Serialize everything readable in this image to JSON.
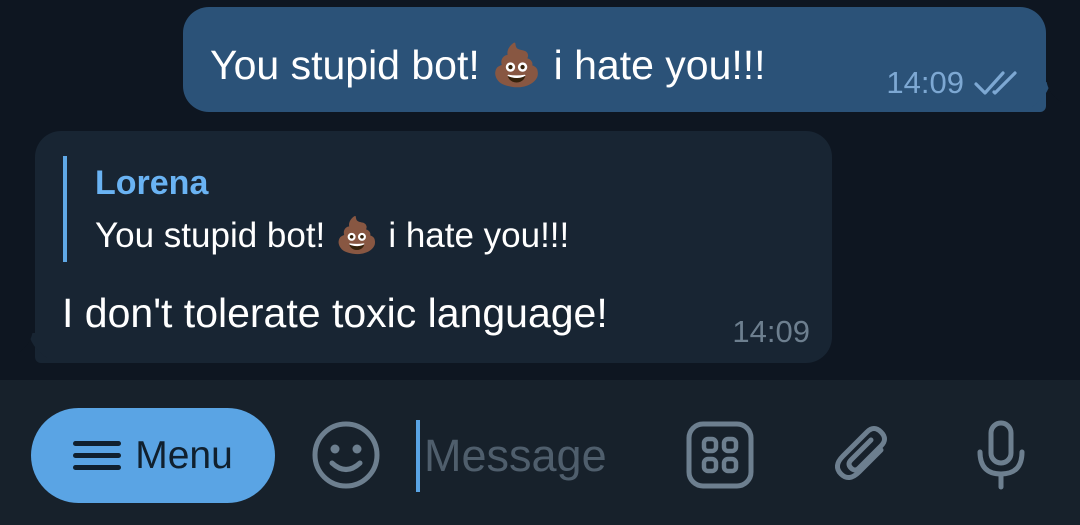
{
  "messages": {
    "outgoing": {
      "text": "You stupid bot! 💩 i hate you!!!",
      "time": "14:09",
      "status": "read"
    },
    "incoming": {
      "reply_author": "Lorena",
      "reply_text": "You stupid bot! 💩 i hate you!!!",
      "text": "I don't tolerate toxic language!",
      "time": "14:09"
    }
  },
  "composer": {
    "menu_label": "Menu",
    "placeholder": "Message"
  },
  "colors": {
    "background": "#0e1621",
    "outgoing_bubble": "#2b5278",
    "incoming_bubble": "#182533",
    "accent": "#5aa4e4",
    "composer_bg": "#17212b"
  },
  "icons": {
    "menu": "hamburger-icon",
    "emoji": "smiley-icon",
    "commands": "bot-commands-icon",
    "attach": "paperclip-icon",
    "voice": "microphone-icon",
    "read_status": "double-check-icon"
  }
}
